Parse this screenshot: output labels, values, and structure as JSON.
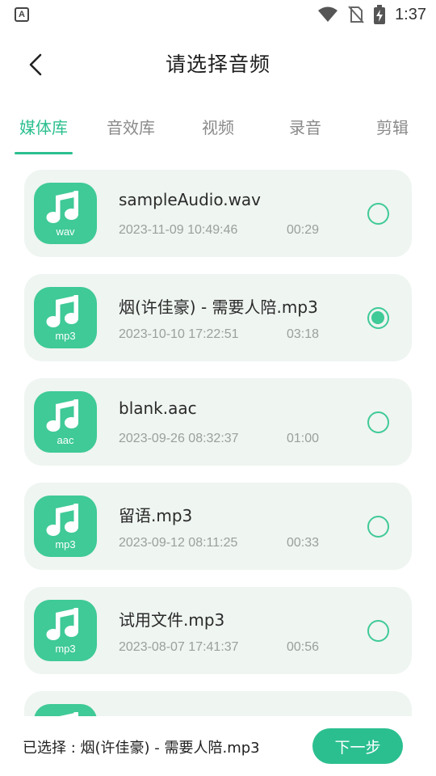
{
  "status_bar": {
    "left_badge": "A",
    "time": "1:37"
  },
  "header": {
    "title": "请选择音频"
  },
  "tabs": [
    {
      "label": "媒体库",
      "active": true
    },
    {
      "label": "音效库",
      "active": false
    },
    {
      "label": "视频",
      "active": false
    },
    {
      "label": "录音",
      "active": false
    },
    {
      "label": "剪辑",
      "active": false
    }
  ],
  "files": [
    {
      "name": "sampleAudio.wav",
      "ext": "wav",
      "date": "2023-11-09 10:49:46",
      "duration": "00:29",
      "selected": false
    },
    {
      "name": "烟(许佳豪) - 需要人陪.mp3",
      "ext": "mp3",
      "date": "2023-10-10 17:22:51",
      "duration": "03:18",
      "selected": true
    },
    {
      "name": "blank.aac",
      "ext": "aac",
      "date": "2023-09-26 08:32:37",
      "duration": "01:00",
      "selected": false
    },
    {
      "name": "留语.mp3",
      "ext": "mp3",
      "date": "2023-09-12 08:11:25",
      "duration": "00:33",
      "selected": false
    },
    {
      "name": "试用文件.mp3",
      "ext": "mp3",
      "date": "2023-08-07 17:41:37",
      "duration": "00:56",
      "selected": false
    },
    {
      "name": "",
      "ext": "",
      "date": "",
      "duration": "",
      "selected": false
    }
  ],
  "bottom": {
    "selected_label": "已选择 : 烟(许佳豪) - 需要人陪.mp3",
    "next_label": "下一步"
  },
  "colors": {
    "accent": "#2bbf8f",
    "thumb": "#3fca97",
    "card_bg": "#eff5f1"
  }
}
